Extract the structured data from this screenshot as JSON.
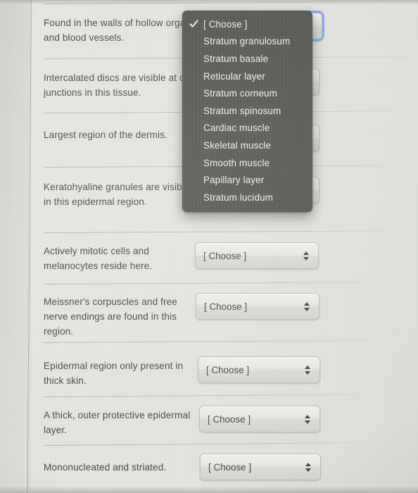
{
  "page": {
    "background_color": "#e3e2dd",
    "text_color": "#3b3a37"
  },
  "quiz": {
    "rows": [
      {
        "prompt": "Found in the walls of hollow organs and blood vessels.",
        "select_value": "[ Choose ]",
        "focused": true
      },
      {
        "prompt": "Intercalated discs are visible at cell junctions in this tissue.",
        "select_value": "[ Choose ]",
        "focused": false
      },
      {
        "prompt": "Largest region of the dermis.",
        "select_value": "[ Choose ]",
        "focused": false
      },
      {
        "prompt": "Keratohyaline granules are visible in this epidermal region.",
        "select_value": "[ Choose ]",
        "focused": false
      },
      {
        "prompt": "Actively mitotic cells and melanocytes reside here.",
        "select_value": "[ Choose ]",
        "focused": false
      },
      {
        "prompt": "Meissner's corpuscles and free nerve endings are found in this region.",
        "select_value": "[ Choose ]",
        "focused": false
      },
      {
        "prompt": "Epidermal region only present in thick skin.",
        "select_value": "[ Choose ]",
        "focused": false
      },
      {
        "prompt": "A thick, outer protective epidermal layer.",
        "select_value": "[ Choose ]",
        "focused": false
      },
      {
        "prompt": "Mononucleated and striated.",
        "select_value": "[ Choose ]",
        "focused": false
      }
    ]
  },
  "dropdown": {
    "open": true,
    "background_color": "#4c4a46",
    "text_color": "#f4f3f1",
    "selected_index": 0,
    "options": [
      "[ Choose ]",
      "Stratum granulosum",
      "Stratum basale",
      "Reticular layer",
      "Stratum corneum",
      "Stratum spinosum",
      "Cardiac muscle",
      "Skeletal muscle",
      "Smooth muscle",
      "Papillary layer",
      "Stratum lucidum"
    ]
  },
  "icons": {
    "checkmark": "check-icon",
    "stepper": "updown-stepper-icon"
  }
}
